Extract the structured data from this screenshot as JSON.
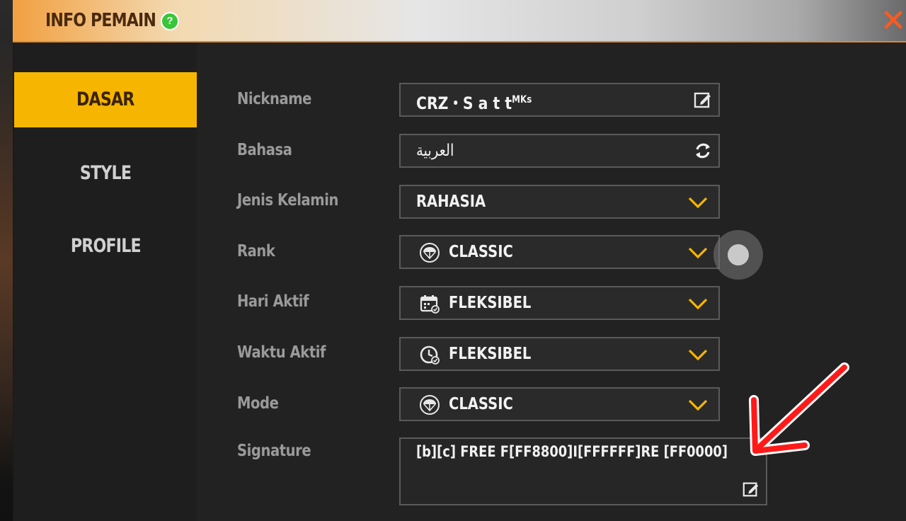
{
  "window": {
    "title": "INFO PEMAIN",
    "help_glyph": "?",
    "close_glyph": "✕"
  },
  "sidebar": {
    "items": [
      {
        "label": "DASAR",
        "active": true
      },
      {
        "label": "STYLE",
        "active": false
      },
      {
        "label": "PROFILE",
        "active": false
      }
    ]
  },
  "fields": {
    "nickname": {
      "label": "Nickname",
      "value_main": "CRZ・S a t t",
      "value_sup": "MKs",
      "icon": "edit-icon"
    },
    "language": {
      "label": "Bahasa",
      "value": "العربية",
      "icon": "refresh-icon"
    },
    "gender": {
      "label": "Jenis Kelamin",
      "value": "RAHASIA",
      "icon": "chevron-down-icon"
    },
    "rank": {
      "label": "Rank",
      "value": "CLASSIC",
      "icon": "parachute-icon"
    },
    "active_days": {
      "label": "Hari Aktif",
      "value": "FLEKSIBEL",
      "icon": "calendar-icon"
    },
    "active_time": {
      "label": "Waktu Aktif",
      "value": "FLEKSIBEL",
      "icon": "clock-icon"
    },
    "mode": {
      "label": "Mode",
      "value": "CLASSIC",
      "icon": "parachute-icon"
    },
    "signature": {
      "label": "Signature",
      "value": "[b][c] FREE F[FF8800]I[FFFFFF]RE [FF0000]",
      "icon": "edit-icon"
    }
  },
  "colors": {
    "accent": "#f6b500",
    "chevron": "#f6b500",
    "close": "#ff5a1f",
    "arrow": "#ff1a1a",
    "help": "#3ac53a"
  }
}
